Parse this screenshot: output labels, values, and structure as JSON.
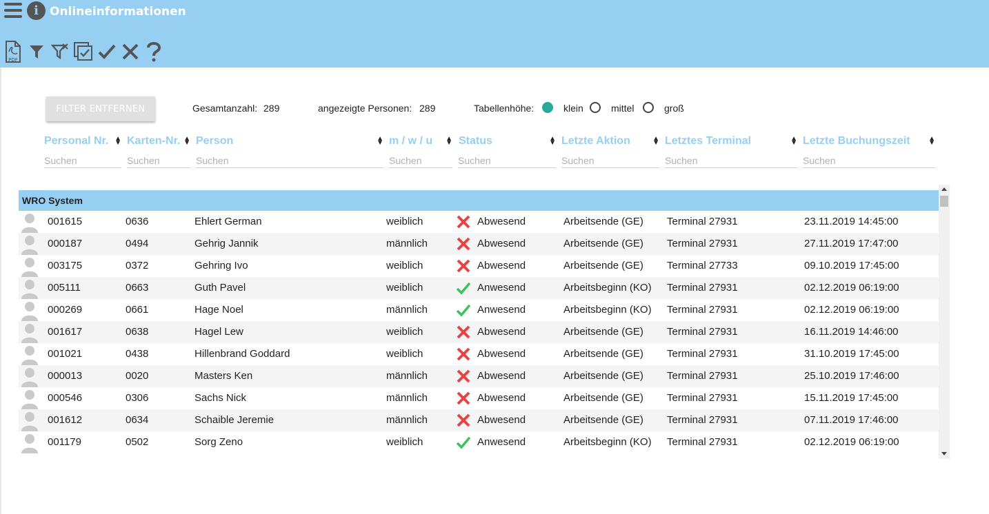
{
  "app": {
    "title": "Onlineinformationen"
  },
  "toolbar": {
    "pdf_label": "PDF",
    "icons": [
      "pdf-export-icon",
      "filter-icon",
      "filter-remove-icon",
      "select-all-icon",
      "check-icon",
      "close-icon",
      "help-icon"
    ]
  },
  "controls": {
    "filter_button": "FILTER ENTFERNEN",
    "total_label": "Gesamtanzahl:",
    "total_value": "289",
    "shown_label": "angezeigte Personen:",
    "shown_value": "289",
    "height_label": "Tabellenhöhe:",
    "height_options": [
      "klein",
      "mittel",
      "groß"
    ],
    "height_selected": "klein"
  },
  "columns": [
    {
      "label": "Personal Nr.",
      "placeholder": "Suchen"
    },
    {
      "label": "Karten-Nr.",
      "placeholder": "Suchen"
    },
    {
      "label": "Person",
      "placeholder": "Suchen"
    },
    {
      "label": "m / w / u",
      "placeholder": "Suchen"
    },
    {
      "label": "Status",
      "placeholder": "Suchen"
    },
    {
      "label": "Letzte Aktion",
      "placeholder": "Suchen"
    },
    {
      "label": "Letztes Terminal",
      "placeholder": "Suchen"
    },
    {
      "label": "Letzte Buchungszeit",
      "placeholder": "Suchen"
    }
  ],
  "group": {
    "name": "WRO System"
  },
  "rows": [
    {
      "personal_nr": "001615",
      "karten_nr": "0636",
      "person": "Ehlert German",
      "gender": "weiblich",
      "present": false,
      "status": "Abwesend",
      "action": "Arbeitsende (GE)",
      "terminal": "Terminal 27931",
      "time": "23.11.2019 14:45:00"
    },
    {
      "personal_nr": "000187",
      "karten_nr": "0494",
      "person": "Gehrig Jannik",
      "gender": "männlich",
      "present": false,
      "status": "Abwesend",
      "action": "Arbeitsende (GE)",
      "terminal": "Terminal 27931",
      "time": "27.11.2019 17:47:00"
    },
    {
      "personal_nr": "003175",
      "karten_nr": "0372",
      "person": "Gehring Ivo",
      "gender": "weiblich",
      "present": false,
      "status": "Abwesend",
      "action": "Arbeitsende (GE)",
      "terminal": "Terminal 27733",
      "time": "09.10.2019 17:45:00"
    },
    {
      "personal_nr": "005111",
      "karten_nr": "0663",
      "person": "Guth Pavel",
      "gender": "weiblich",
      "present": true,
      "status": "Anwesend",
      "action": "Arbeitsbeginn (KO)",
      "terminal": "Terminal 27931",
      "time": "02.12.2019 06:19:00"
    },
    {
      "personal_nr": "000269",
      "karten_nr": "0661",
      "person": "Hage Noel",
      "gender": "männlich",
      "present": true,
      "status": "Anwesend",
      "action": "Arbeitsbeginn (KO)",
      "terminal": "Terminal 27931",
      "time": "02.12.2019 06:19:00"
    },
    {
      "personal_nr": "001617",
      "karten_nr": "0638",
      "person": "Hagel Lew",
      "gender": "weiblich",
      "present": false,
      "status": "Abwesend",
      "action": "Arbeitsende (GE)",
      "terminal": "Terminal 27931",
      "time": "16.11.2019 14:46:00"
    },
    {
      "personal_nr": "001021",
      "karten_nr": "0438",
      "person": "Hillenbrand Goddard",
      "gender": "weiblich",
      "present": false,
      "status": "Abwesend",
      "action": "Arbeitsende (GE)",
      "terminal": "Terminal 27931",
      "time": "31.10.2019 17:45:00"
    },
    {
      "personal_nr": "000013",
      "karten_nr": "0020",
      "person": "Masters Ken",
      "gender": "männlich",
      "present": false,
      "status": "Abwesend",
      "action": "Arbeitsende (GE)",
      "terminal": "Terminal 27931",
      "time": "25.10.2019 17:46:00"
    },
    {
      "personal_nr": "000546",
      "karten_nr": "0306",
      "person": "Sachs Nick",
      "gender": "männlich",
      "present": false,
      "status": "Abwesend",
      "action": "Arbeitsende (GE)",
      "terminal": "Terminal 27931",
      "time": "15.11.2019 17:45:00"
    },
    {
      "personal_nr": "001612",
      "karten_nr": "0634",
      "person": "Schaible Jeremie",
      "gender": "männlich",
      "present": false,
      "status": "Abwesend",
      "action": "Arbeitsende (GE)",
      "terminal": "Terminal 27931",
      "time": "07.11.2019 17:46:00"
    },
    {
      "personal_nr": "001179",
      "karten_nr": "0502",
      "person": "Sorg Zeno",
      "gender": "weiblich",
      "present": true,
      "status": "Anwesend",
      "action": "Arbeitsbeginn (KO)",
      "terminal": "Terminal 27931",
      "time": "02.12.2019 06:19:00"
    }
  ],
  "colors": {
    "accent": "#97cff3",
    "present": "#3cc35a",
    "absent": "#e84343",
    "radio_selected": "#2aa89a"
  }
}
